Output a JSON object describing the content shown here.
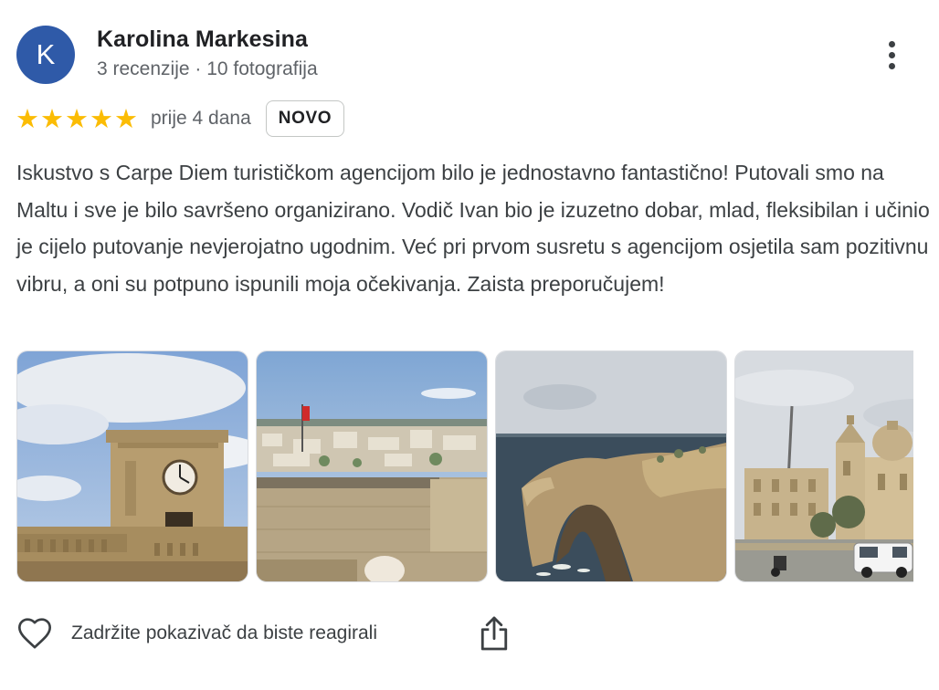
{
  "reviewer": {
    "initial": "K",
    "name": "Karolina Markesina",
    "meta": "3 recenzije · 10 fotografija",
    "avatar_color": "#2f5aa8"
  },
  "menu": {
    "icon": "more-vert-icon"
  },
  "rating": {
    "stars": 5,
    "max_stars": 5,
    "star_color": "#fbbc04",
    "date": "prije 4 dana",
    "badge": "NOVO"
  },
  "review_text": "Iskustvo s Carpe Diem turističkom agencijom bilo je jednostavno fantastično! Putovali smo na Maltu i sve je bilo savršeno organizirano. Vodič Ivan bio je izuzetno dobar, mlad, fleksibilan i učinio je cijelo putovanje nevjerojatno ugodnim. Već pri prvom susretu s agencijom osjetila sam pozitivnu vibru, a oni su potpuno ispunili moja očekivanja. Zaista preporučujem!",
  "photos": [
    {
      "subject": "stone clock tower under cloudy blue sky"
    },
    {
      "subject": "town rooftops view from fortress walls"
    },
    {
      "subject": "coastal rock arch by the sea"
    },
    {
      "subject": "church with domes and parked van"
    }
  ],
  "actions": {
    "react_label": "Zadržite pokazivač da biste reagirali",
    "react_icon": "heart-outline-icon",
    "share_icon": "share-icon"
  }
}
